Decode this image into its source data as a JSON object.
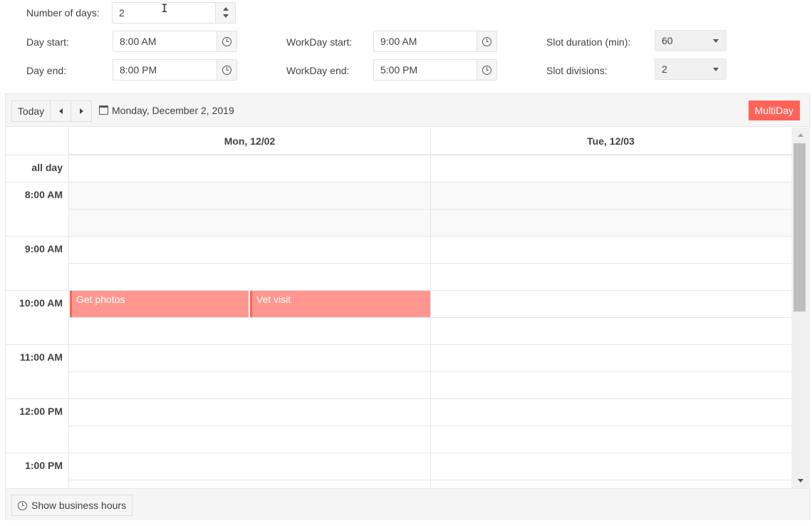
{
  "config": {
    "number_of_days": {
      "label": "Number of days:",
      "value": "2"
    },
    "day_start": {
      "label": "Day start:",
      "value": "8:00 AM"
    },
    "day_end": {
      "label": "Day end:",
      "value": "8:00 PM"
    },
    "workday_start": {
      "label": "WorkDay start:",
      "value": "9:00 AM"
    },
    "workday_end": {
      "label": "WorkDay end:",
      "value": "5:00 PM"
    },
    "slot_duration": {
      "label": "Slot duration (min):",
      "value": "60"
    },
    "slot_divisions": {
      "label": "Slot divisions:",
      "value": "2"
    }
  },
  "toolbar": {
    "today_label": "Today",
    "date_text": "Monday, December 2, 2019",
    "view_label": "MultiDay"
  },
  "columns": [
    "Mon, 12/02",
    "Tue, 12/03"
  ],
  "all_day_label": "all day",
  "time_slots": [
    "8:00 AM",
    "9:00 AM",
    "10:00 AM",
    "11:00 AM",
    "12:00 PM",
    "1:00 PM"
  ],
  "events": [
    {
      "title": "Get photos"
    },
    {
      "title": "Vet visit"
    }
  ],
  "footer": {
    "business_hours_label": "Show business hours"
  },
  "colors": {
    "accent": "#ff6358",
    "event_bg": "#ff9790"
  },
  "icons": [
    "clock-icon",
    "calendar-icon",
    "caret-left-icon",
    "caret-right-icon",
    "caret-down-icon",
    "spinner-up-icon",
    "spinner-down-icon",
    "text-cursor-icon"
  ]
}
